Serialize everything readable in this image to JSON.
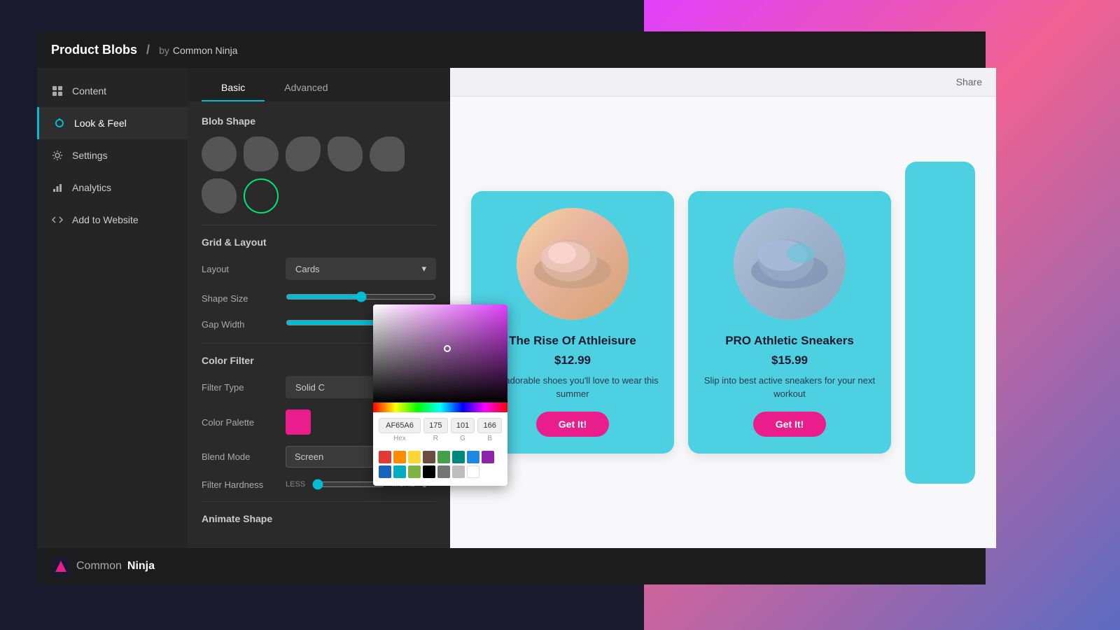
{
  "app": {
    "title": "Product Blobs",
    "separator": "/",
    "by": "by",
    "brand": "Common Ninja"
  },
  "sidebar": {
    "items": [
      {
        "id": "content",
        "label": "Content",
        "icon": "grid-icon"
      },
      {
        "id": "look-feel",
        "label": "Look & Feel",
        "icon": "brush-icon",
        "active": true
      },
      {
        "id": "settings",
        "label": "Settings",
        "icon": "gear-icon"
      },
      {
        "id": "analytics",
        "label": "Analytics",
        "icon": "chart-icon"
      },
      {
        "id": "add-to-website",
        "label": "Add to Website",
        "icon": "code-icon"
      }
    ]
  },
  "tabs": {
    "basic": "Basic",
    "advanced": "Advanced"
  },
  "settings": {
    "blob_shape_title": "Blob Shape",
    "grid_layout_title": "Grid & Layout",
    "layout_label": "Layout",
    "layout_value": "Cards",
    "shape_size_label": "Shape Size",
    "gap_width_label": "Gap Width",
    "color_filter_title": "Color Filter",
    "filter_type_label": "Filter Type",
    "filter_type_value": "Solid C",
    "color_palette_label": "Color Palette",
    "blend_mode_label": "Blend Mode",
    "blend_mode_value": "Screen",
    "filter_hardness_label": "Filter Hardness",
    "filter_hardness_less": "LESS",
    "filter_hardness_more": "MORE",
    "filter_hardness_value": "0",
    "animate_shape_title": "Animate Shape"
  },
  "color_picker": {
    "hex": "AF65A6",
    "r": "175",
    "g": "101",
    "b": "166",
    "hex_label": "Hex",
    "r_label": "R",
    "g_label": "G",
    "b_label": "B"
  },
  "preview": {
    "share_button": "Share",
    "products": [
      {
        "id": "1",
        "title": "The Rise Of Athleisure",
        "price": "$12.99",
        "description": "The adorable shoes you'll love to wear this summer",
        "button": "Get It!"
      },
      {
        "id": "2",
        "title": "PRO Athletic Sneakers",
        "price": "$15.99",
        "description": "Slip into best active sneakers for your next workout",
        "button": "Get It!"
      }
    ]
  },
  "footer": {
    "brand": "CommonNinja"
  },
  "swatches": {
    "row1": [
      "#e53935",
      "#fb8c00",
      "#fdd835",
      "#6d4c41",
      "#43a047",
      "#00897b",
      "#1e88e5",
      "#8e24aa"
    ],
    "row2": [
      "#1565c0",
      "#00acc1",
      "#7cb342",
      "#000000",
      "#757575",
      "#bdbdbd",
      "#ffffff",
      ""
    ]
  }
}
